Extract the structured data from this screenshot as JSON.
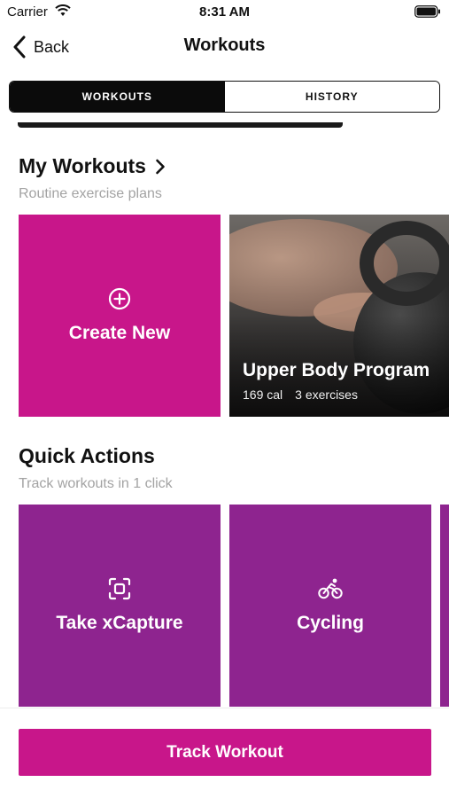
{
  "status_bar": {
    "carrier": "Carrier",
    "time": "8:31 AM",
    "icons": [
      "wifi-icon",
      "battery-icon"
    ]
  },
  "nav": {
    "back_label": "Back",
    "title": "Workouts"
  },
  "segments": [
    {
      "label": "WORKOUTS",
      "selected": true
    },
    {
      "label": "HISTORY",
      "selected": false
    }
  ],
  "my_workouts": {
    "title": "My Workouts",
    "subtitle": "Routine exercise plans",
    "create_new_label": "Create New",
    "program": {
      "title": "Upper Body Program",
      "calories": "169 cal",
      "exercises": "3 exercises"
    }
  },
  "quick_actions": {
    "title": "Quick Actions",
    "subtitle": "Track workouts in 1 click",
    "items": [
      {
        "label": "Take xCapture",
        "icon": "scan-icon"
      },
      {
        "label": "Cycling",
        "icon": "cycling-icon"
      }
    ]
  },
  "track_button_label": "Track Workout",
  "colors": {
    "magenta": "#c8168a",
    "purple": "#8e248f",
    "segment_active": "#0b0b0b"
  }
}
